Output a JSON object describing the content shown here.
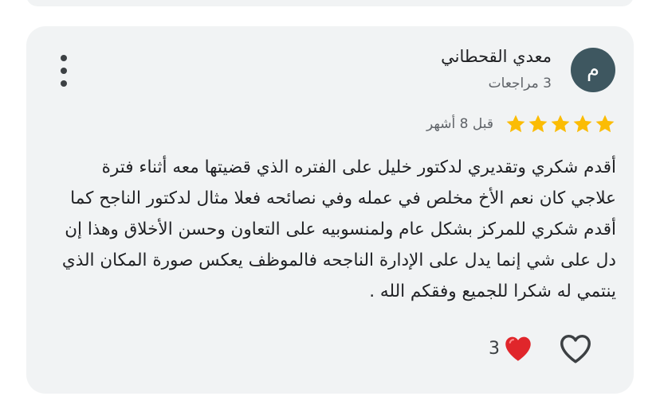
{
  "review": {
    "avatar_letter": "م",
    "author_name": "معدي القحطاني",
    "author_reviews": "3 مراجعات",
    "rating": 5,
    "rating_max": 5,
    "date": "قبل 8 أشهر",
    "text": "أقدم شكري وتقديري لدكتور خليل على الفتره الذي قضيتها معه أثناء فترة علاجي كان نعم الأخ مخلص في عمله وفي نصائحه فعلا مثال لدكتور الناجح كما أقدم شكري للمركز بشكل عام ولمنسوبيه على التعاون وحسن الأخلاق وهذا إن دل على شي إنما يدل على الإدارة الناجحه فالموظف يعكس صورة المكان الذي ينتمي له شكرا للجميع وفقكم الله .",
    "reaction_count": "3"
  },
  "icons": {
    "more": "more-vert-icon",
    "star": "star-icon",
    "like": "heart-outline-icon",
    "reaction": "red-heart-icon"
  },
  "colors": {
    "card_background": "#f1f3f4",
    "avatar_background": "#3e5760",
    "star": "#fbbc04",
    "heart_reaction": "#e0262b"
  }
}
